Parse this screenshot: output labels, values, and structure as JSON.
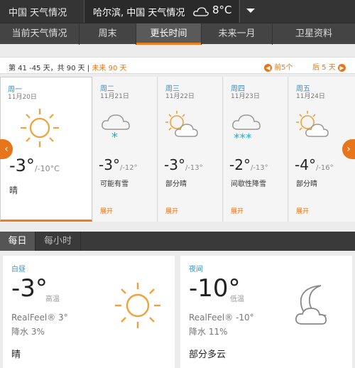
{
  "topbar": {
    "brand": "中国 天气情况",
    "location": "哈尔滨, 中国 天气情况",
    "current_temp": "8°C",
    "icon": "cloud-icon"
  },
  "tabs": [
    {
      "label": "当前天气情况",
      "active": false
    },
    {
      "label": "周末",
      "active": false
    },
    {
      "label": "更长时间",
      "active": true
    },
    {
      "label": "未来一月",
      "active": false
    },
    {
      "label": "卫星资料",
      "active": false
    }
  ],
  "range": {
    "info": "第 41 -45 天，共 90 天 | ",
    "future": "未来 90 天",
    "prev": "前5个",
    "next": "后 5 天"
  },
  "days": [
    {
      "name": "周一",
      "date": "11月20日",
      "hi": "-3°",
      "lo": "/-10°C",
      "cond": "晴",
      "icon": "sun-icon",
      "expand": ""
    },
    {
      "name": "周二",
      "date": "11月21日",
      "hi": "-3°",
      "lo": "/-12°",
      "cond": "可能有雪",
      "icon": "snow-cloud-icon",
      "expand": "展开"
    },
    {
      "name": "周三",
      "date": "11月22日",
      "hi": "-3°",
      "lo": "/-13°",
      "cond": "部分晴",
      "icon": "partly-sunny-icon",
      "expand": "展开"
    },
    {
      "name": "周四",
      "date": "11月23日",
      "hi": "-2°",
      "lo": "/-13°",
      "cond": "间歇性降雪",
      "icon": "flurries-icon",
      "expand": "展开"
    },
    {
      "name": "周五",
      "date": "11月24日",
      "hi": "-4°",
      "lo": "/-16°",
      "cond": "部分晴",
      "icon": "partly-sunny-icon",
      "expand": "展开"
    }
  ],
  "subtabs": [
    {
      "label": "每日",
      "active": true
    },
    {
      "label": "每小时",
      "active": false
    }
  ],
  "day_card": {
    "label": "白昼",
    "temp": "-3°",
    "temp_label": "高温",
    "realfeel": "RealFeel® 3°",
    "precip": "降水 3%",
    "cond": "晴",
    "icon": "sun-icon"
  },
  "night_card": {
    "label": "夜间",
    "temp": "-10°",
    "temp_label": "低温",
    "realfeel": "RealFeel® -10°",
    "precip": "降水 11%",
    "cond": "部分多云",
    "icon": "moon-cloud-icon"
  },
  "colors": {
    "accent": "#e8751a",
    "sun": "#f0a23a",
    "snow": "#23b3c5",
    "link": "#3a8fc5"
  }
}
